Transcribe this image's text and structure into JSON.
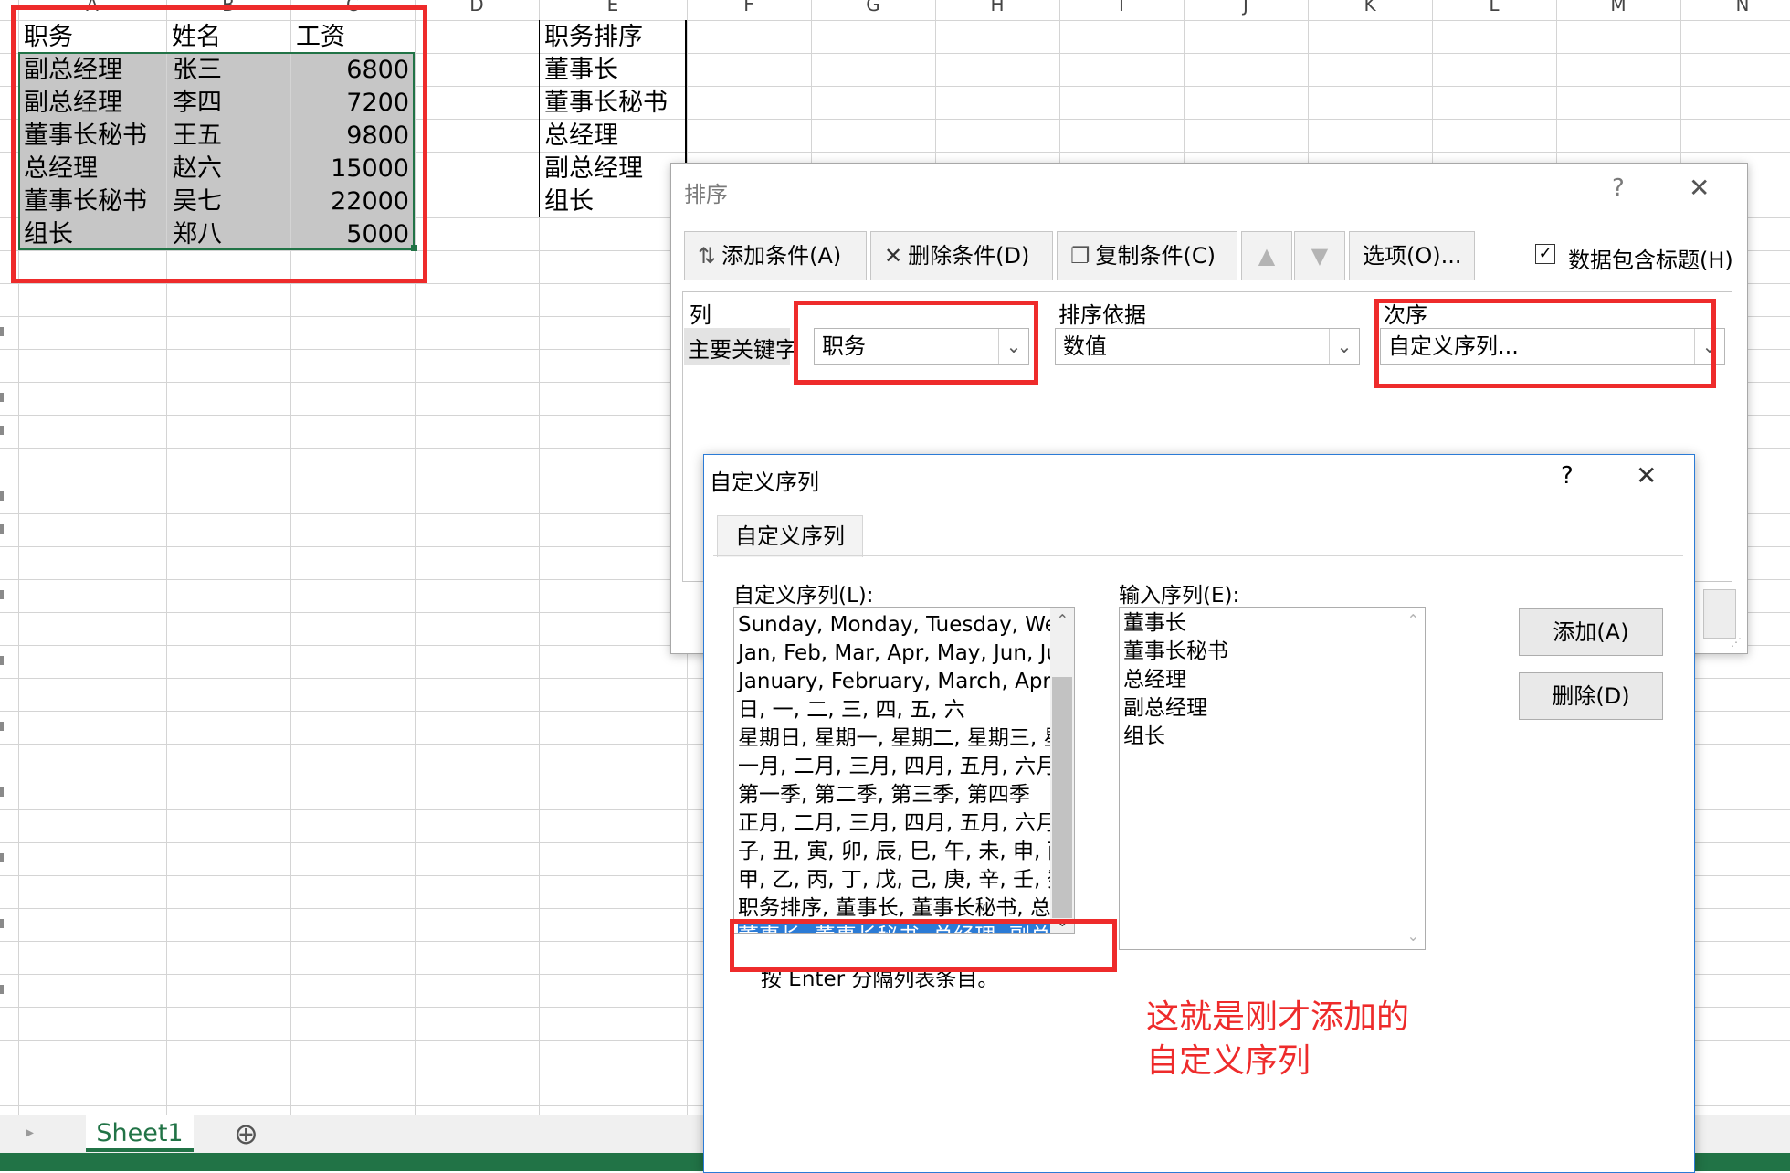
{
  "sheet": {
    "col_letters": [
      "A",
      "B",
      "C",
      "D",
      "E",
      "F",
      "G",
      "H",
      "I",
      "J",
      "K",
      "L",
      "M",
      "N"
    ],
    "headers": [
      "职务",
      "姓名",
      "工资"
    ],
    "rows": [
      [
        "副总经理",
        "张三",
        "6800"
      ],
      [
        "副总经理",
        "李四",
        "7200"
      ],
      [
        "董事长秘书",
        "王五",
        "9800"
      ],
      [
        "总经理",
        "赵六",
        "15000"
      ],
      [
        "董事长秘书",
        "吴七",
        "22000"
      ],
      [
        "组长",
        "郑八",
        "5000"
      ]
    ],
    "order_header": "职务排序",
    "order_list": [
      "董事长",
      "董事长秘书",
      "总经理",
      "副总经理",
      "组长"
    ],
    "tab_name": "Sheet1",
    "add_sheet_symbol": "⊕"
  },
  "sort_dialog": {
    "title": "排序",
    "help": "?",
    "close": "✕",
    "add_condition": "添加条件(A)",
    "delete_condition": "删除条件(D)",
    "copy_condition": "复制条件(C)",
    "options": "选项(O)...",
    "has_headers_label": "数据包含标题(H)",
    "has_headers_checked": "✓",
    "col_header": "列",
    "sort_on_header": "排序依据",
    "order_header": "次序",
    "primary_key_label": "主要关键字",
    "column_value": "职务",
    "sort_on_value": "数值",
    "order_value": "自定义序列..."
  },
  "custom_list_dialog": {
    "title": "自定义序列",
    "help": "?",
    "close": "✕",
    "tab": "自定义序列",
    "lists_label": "自定义序列(L):",
    "entries_label": "输入序列(E):",
    "lists": [
      "Sunday, Monday, Tuesday, Wed",
      "Jan, Feb, Mar, Apr, May, Jun, Jul",
      "January, February, March, April,",
      "日, 一, 二, 三, 四, 五, 六",
      "星期日, 星期一, 星期二, 星期三, 星",
      "一月, 二月, 三月, 四月, 五月, 六月,",
      "第一季, 第二季, 第三季, 第四季",
      "正月, 二月, 三月, 四月, 五月, 六月,",
      "子, 丑, 寅, 卯, 辰, 巳, 午, 未, 申, 酉,",
      "甲, 乙, 丙, 丁, 戊, 己, 庚, 辛, 壬, 癸",
      "职务排序, 董事长, 董事长秘书, 总经",
      "董事长, 董事长秘书, 总经理, 副总经"
    ],
    "entries": [
      "董事长",
      "董事长秘书",
      "总经理",
      "副总经理",
      "组长"
    ],
    "add_button": "添加(A)",
    "delete_button": "删除(D)",
    "hint": "按 Enter 分隔列表条目。",
    "annotation_line1": "这就是刚才添加的",
    "annotation_line2": "自定义序列"
  },
  "colors": {
    "accent": "#2b7bd6",
    "annotation": "#ee2b2b",
    "excel_green": "#217346"
  }
}
